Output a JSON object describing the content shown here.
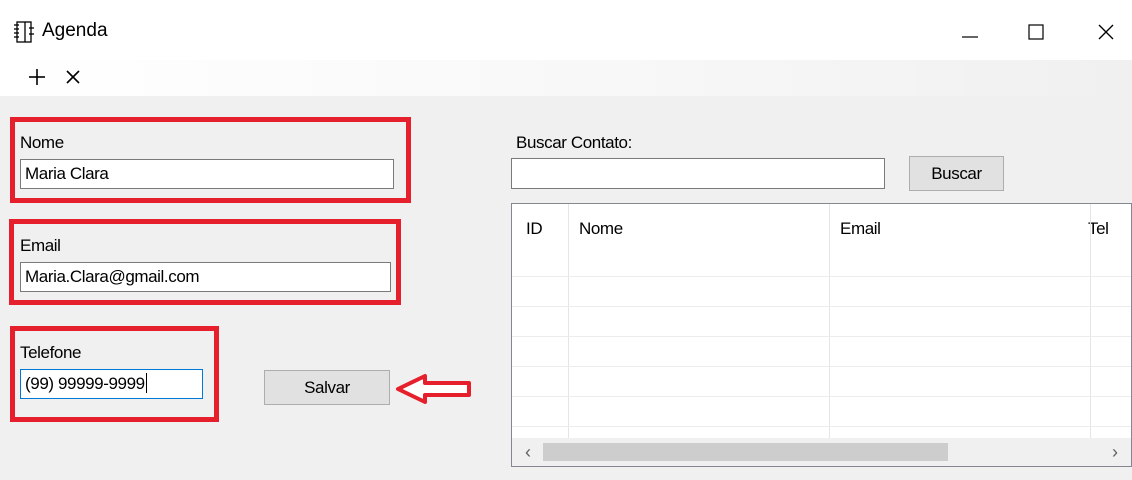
{
  "window": {
    "title": "Agenda",
    "icon": "notebook-icon",
    "controls": [
      "minimize-icon",
      "maximize-icon",
      "close-icon"
    ]
  },
  "toolbar": {
    "items": [
      {
        "icon": "plus-icon"
      },
      {
        "icon": "close-x-icon"
      }
    ]
  },
  "form": {
    "nome": {
      "label": "Nome",
      "value": "Maria Clara"
    },
    "email": {
      "label": "Email",
      "value": "Maria.Clara@gmail.com"
    },
    "telefone": {
      "label": "Telefone",
      "value": "(99) 99999-9999"
    },
    "save_label": "Salvar"
  },
  "search": {
    "label": "Buscar Contato:",
    "value": "",
    "button_label": "Buscar"
  },
  "grid": {
    "columns": [
      "ID",
      "Nome",
      "Email",
      "Tel"
    ],
    "rows": []
  },
  "annotations": {
    "highlight_color": "#e51f2b",
    "arrow_icon": "left-arrow-icon"
  },
  "colors": {
    "focus_border": "#0078d7",
    "button_bg": "#e1e1e1",
    "window_bg": "#f0f0f0"
  }
}
